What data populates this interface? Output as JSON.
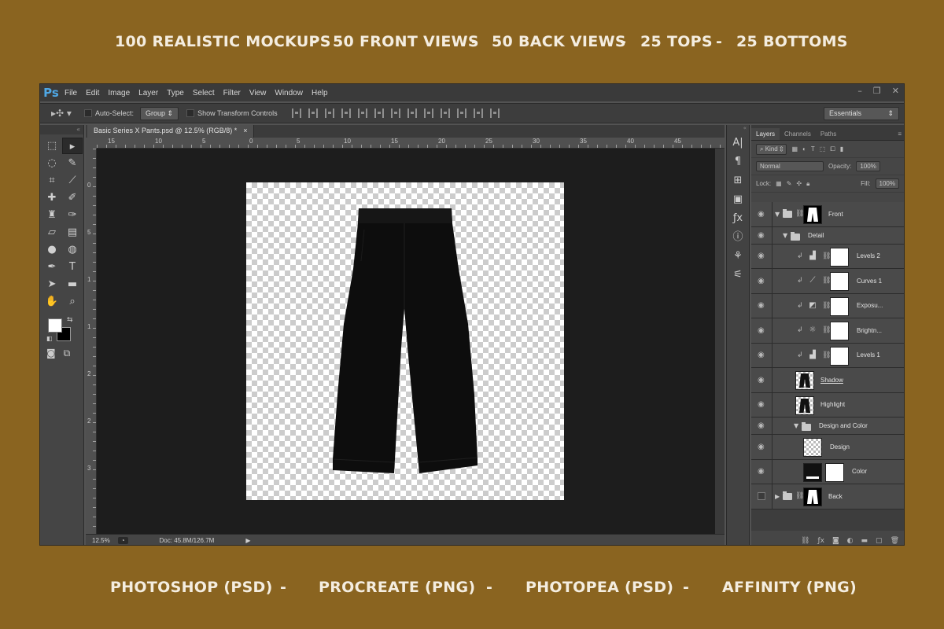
{
  "banner_top": {
    "item1": "100 REALISTIC MOCKUPS",
    "sep1": "-",
    "item2": "50 FRONT VIEWS",
    "sep2": "-",
    "item3": "50 BACK VIEWS",
    "sep3": "-",
    "item4": "25 TOPS",
    "sep4": "-",
    "item5": "25 BOTTOMS"
  },
  "banner_bottom": {
    "item1": "PHOTOSHOP (PSD)",
    "sep1": "-",
    "item2": "PROCREATE (PNG)",
    "sep2": "-",
    "item3": "PHOTOPEA (PSD)",
    "sep3": "-",
    "item4": "AFFINITY (PNG)"
  },
  "colors": {
    "background": "#8a6420",
    "ps_blue": "#4fa8e6",
    "canvas": "#1d1d1d"
  },
  "app": {
    "logo": "Ps",
    "menu": [
      "File",
      "Edit",
      "Image",
      "Layer",
      "Type",
      "Select",
      "Filter",
      "View",
      "Window",
      "Help"
    ],
    "window_controls": [
      "–",
      "❐",
      "✕"
    ]
  },
  "options": {
    "auto_select_label": "Auto-Select:",
    "auto_select_value": "Group",
    "transform_label": "Show Transform Controls",
    "workspace": "Essentials"
  },
  "document": {
    "tab_title": "Basic Series X Pants.psd @ 12.5% (RGB/8) *",
    "tab_close": "×",
    "ruler_top": [
      "15",
      "10",
      "5",
      "0",
      "5",
      "10",
      "15",
      "20",
      "25",
      "30",
      "35",
      "40",
      "45"
    ],
    "ruler_left": [
      "0",
      "5",
      "1",
      "1",
      "2",
      "2",
      "3"
    ],
    "zoom": "12.5%",
    "doc_info": "Doc: 45.8M/126.7M"
  },
  "layers_panel": {
    "tabs": [
      "Layers",
      "Channels",
      "Paths"
    ],
    "filter_label": "Kind",
    "blend_mode": "Normal",
    "opacity_label": "Opacity:",
    "opacity_value": "100%",
    "lock_label": "Lock:",
    "fill_label": "Fill:",
    "fill_value": "100%",
    "layers": [
      {
        "name": "Front",
        "type": "group-mask"
      },
      {
        "name": "Detail",
        "type": "folder"
      },
      {
        "name": "Levels 2",
        "type": "adjustment",
        "icon": "levels-icon"
      },
      {
        "name": "Curves 1",
        "type": "adjustment",
        "icon": "curves-icon"
      },
      {
        "name": "Exposu...",
        "type": "adjustment",
        "icon": "exposure-icon"
      },
      {
        "name": "Brightn...",
        "type": "adjustment",
        "icon": "brightness-icon"
      },
      {
        "name": "Levels 1",
        "type": "adjustment",
        "icon": "levels-icon"
      },
      {
        "name": "Shadow",
        "type": "image"
      },
      {
        "name": "Highlight",
        "type": "image"
      },
      {
        "name": "Design and Color",
        "type": "folder"
      },
      {
        "name": "Design",
        "type": "smart"
      },
      {
        "name": "Color",
        "type": "fill"
      },
      {
        "name": "Back",
        "type": "group-mask-hidden"
      }
    ]
  }
}
